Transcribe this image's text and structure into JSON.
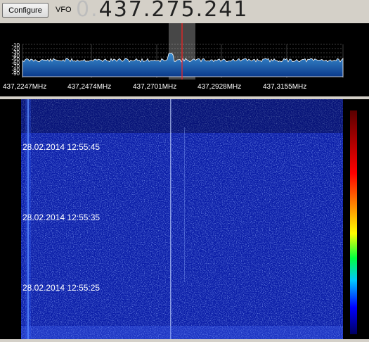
{
  "toolbar": {
    "configure_label": "Configure",
    "vfo_label": "VFO",
    "vfo_prefix": "0.",
    "vfo_value": "437.275.241"
  },
  "spectrum": {
    "db_ticks": [
      "-10",
      "-20",
      "-30",
      "-40",
      "-50",
      "-60",
      "-70",
      "-80",
      "-90"
    ],
    "freq_labels": [
      "437,2247MHz",
      "437,2474MHz",
      "437,2701MHz",
      "437,2928MHz",
      "437,3155MHz"
    ],
    "colors": {
      "fill_top": "#3c8fd0",
      "fill_bottom": "#0b3a8c",
      "marker": "#ff2020",
      "trace": "#ffffff"
    }
  },
  "waterfall": {
    "timestamps": [
      "28.02.2014 12:55:45",
      "28.02.2014 12:55:35",
      "28.02.2014 12:55:25"
    ],
    "colors": {
      "background": "#0b1ea8",
      "palette": [
        "#5a0000",
        "#ff0000",
        "#ffa000",
        "#ffff00",
        "#00ff40",
        "#00c8ff",
        "#0000ff",
        "#000060"
      ]
    }
  }
}
